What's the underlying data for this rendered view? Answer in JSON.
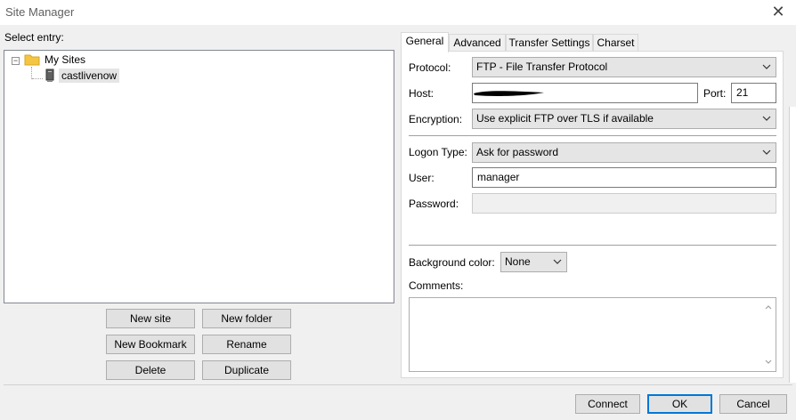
{
  "window": {
    "title": "Site Manager"
  },
  "left": {
    "select_entry_label": "Select entry:",
    "tree": {
      "root_label": "My Sites",
      "children": [
        {
          "label": "castlivenow"
        }
      ]
    },
    "buttons": {
      "new_site": "New site",
      "new_folder": "New folder",
      "new_bookmark": "New Bookmark",
      "rename": "Rename",
      "delete": "Delete",
      "duplicate": "Duplicate"
    }
  },
  "tabs": [
    {
      "label": "General",
      "active": true
    },
    {
      "label": "Advanced",
      "active": false
    },
    {
      "label": "Transfer Settings",
      "active": false
    },
    {
      "label": "Charset",
      "active": false
    }
  ],
  "general": {
    "protocol_label": "Protocol:",
    "protocol_value": "FTP - File Transfer Protocol",
    "host_label": "Host:",
    "host_value": "",
    "port_label": "Port:",
    "port_value": "21",
    "encryption_label": "Encryption:",
    "encryption_value": "Use explicit FTP over TLS if available",
    "logon_type_label": "Logon Type:",
    "logon_type_value": "Ask for password",
    "user_label": "User:",
    "user_value": "manager",
    "password_label": "Password:",
    "password_value": "",
    "background_color_label": "Background color:",
    "background_color_value": "None",
    "comments_label": "Comments:",
    "comments_value": ""
  },
  "footer": {
    "connect": "Connect",
    "ok": "OK",
    "cancel": "Cancel"
  },
  "colors": {
    "dialog_bg": "#f0f0f0",
    "panel_bg": "#ffffff",
    "button_bg": "#e1e1e1",
    "default_button_border": "#0078d7",
    "folder": "#f4c542"
  }
}
